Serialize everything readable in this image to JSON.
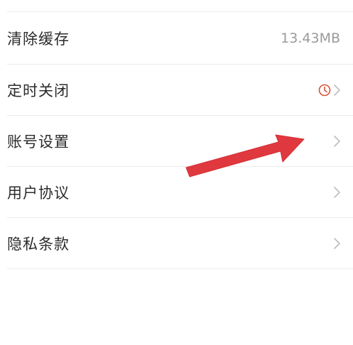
{
  "settings": {
    "items": [
      {
        "label": "清除缓存",
        "value": "13.43MB"
      },
      {
        "label": "定时关闭",
        "icon": "clock-icon"
      },
      {
        "label": "账号设置"
      },
      {
        "label": "用户协议"
      },
      {
        "label": "隐私条款"
      }
    ]
  },
  "colors": {
    "label": "#2b2b2b",
    "value": "#9a9a9a",
    "chevron": "#bdbdbd",
    "clock": "#d2533d",
    "annotation_arrow": "#e0383f",
    "divider": "#ececec"
  },
  "annotation": {
    "icon": "red-arrow-pointing-to-account-settings"
  }
}
